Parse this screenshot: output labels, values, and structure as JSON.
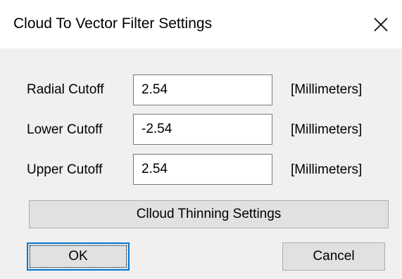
{
  "window": {
    "title": "Cloud To Vector Filter Settings",
    "close_icon": "close-icon"
  },
  "fields": [
    {
      "label": "Radial Cutoff",
      "value": "2.54",
      "unit": "[Millimeters]"
    },
    {
      "label": "Lower Cutoff",
      "value": "-2.54",
      "unit": "[Millimeters]"
    },
    {
      "label": "Upper Cutoff",
      "value": "2.54",
      "unit": "[Millimeters]"
    }
  ],
  "buttons": {
    "thinning_label": "Clloud Thinning Settings",
    "ok_label": "OK",
    "cancel_label": "Cancel"
  },
  "colors": {
    "dialog_background": "#f0f0f0",
    "titlebar_background": "#ffffff",
    "button_background": "#e1e1e1",
    "focus_accent": "#0078d7"
  }
}
